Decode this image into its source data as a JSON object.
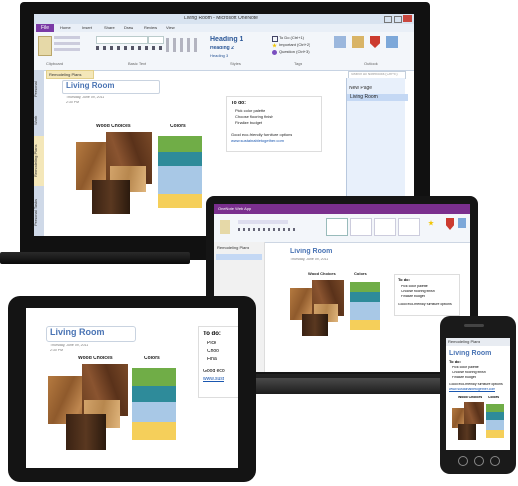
{
  "desktop": {
    "window_title": "Living Room - Microsoft OneNote",
    "file_tab": "File",
    "tabs": [
      "Home",
      "Insert",
      "Share",
      "Draw",
      "Review",
      "View"
    ],
    "styles": {
      "heading1": "Heading 1",
      "heading2": "Heading 2",
      "heading3": "Heading 3"
    },
    "tags": [
      "To Do (Ctrl+1)",
      "Important (Ctrl+2)",
      "Question (Ctrl+3)"
    ],
    "group_labels": [
      "Clipboard",
      "Basic Text",
      "Styles",
      "Tags",
      "Outlook"
    ],
    "notebook_tab": "Remodeling Plans",
    "nav_tabs": [
      "Personal",
      "Work",
      "Remodeling Plans",
      "Personal Tasks"
    ],
    "search_placeholder": "Search All Notebooks (Ctrl+E)",
    "new_page": "New Page",
    "page_list": [
      "Living Room"
    ],
    "page": {
      "title": "Living Room",
      "date": "Thursday, June 09, 2011",
      "time": "2:30 PM",
      "wood_label": "Wood Choices",
      "colors_label": "Colors",
      "todo_heading": "To do:",
      "todo_items": [
        "Pick color palette",
        "Choose flooring finish",
        "Finalize budget"
      ],
      "todo_note": "Good eco-friendly furniture options",
      "todo_link": "www.sustainabletogether.com"
    }
  },
  "laptop": {
    "title": "OneNote Web App",
    "page_title": "Living Room",
    "page_date": "Thursday, June 09, 2011",
    "wood_label": "Wood Choices",
    "colors_label": "Colors",
    "todo_heading": "To do:",
    "todo_items": [
      "Pick color palette",
      "Choose flooring finish",
      "Finalize budget"
    ],
    "todo_note": "Good eco-friendly furniture options",
    "nav_item": "Remodeling Plans"
  },
  "tablet": {
    "page_title": "Living Room",
    "page_date": "Thursday, June 09, 2011",
    "page_time": "2:30 PM",
    "wood_label": "Wood Choices",
    "colors_label": "Colors",
    "todo_heading": "To do:",
    "todo_items": [
      "Pick",
      "Choo",
      "Fina"
    ],
    "todo_note": "Good eco",
    "todo_link": "www.sust"
  },
  "phone": {
    "notebook": "Remodeling Plans",
    "page_title": "Living Room",
    "todo_heading": "To do:",
    "todo_items": [
      "Pick color palette",
      "Choose flooring finish",
      "Finalize budget"
    ],
    "todo_note": "Good eco-friendly furniture options",
    "todo_link": "www.sustainabletogether.com",
    "wood_label": "Wood Choices",
    "colors_label": "Colors"
  }
}
